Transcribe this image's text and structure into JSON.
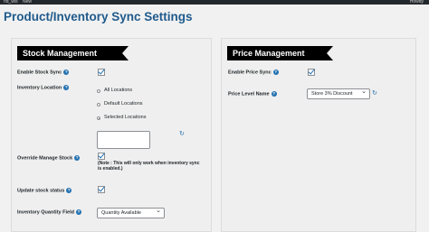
{
  "adminbar": {
    "site": "hd_wis",
    "new": "New",
    "user": "Howdy"
  },
  "page": {
    "title": "Product/Inventory Sync Settings"
  },
  "stock": {
    "heading": "Stock Management",
    "enable_stock_sync": {
      "label": "Enable Stock Sync",
      "checked": true
    },
    "inventory_location": {
      "label": "Inventory Location",
      "options": [
        "All Locations",
        "Default Locations",
        "Selected Locations"
      ],
      "selected": "Selected Locations"
    },
    "override_manage_stock": {
      "label": "Override Manage Stock",
      "checked": true,
      "note": "(Note : This will only work when inventory sync is enabled.)"
    },
    "update_stock_status": {
      "label": "Update stock status",
      "checked": true
    },
    "inventory_quantity_field": {
      "label": "Inventory Quantity Field",
      "value": "Quantity Available"
    }
  },
  "price": {
    "heading": "Price Management",
    "enable_price_sync": {
      "label": "Enable Price Sync",
      "checked": true
    },
    "price_level_name": {
      "label": "Price Level Name",
      "value": "Store 3% Discount"
    }
  },
  "colors": {
    "title": "#1f5a8c",
    "accent": "#2271b1",
    "ribbon": "#000000"
  }
}
